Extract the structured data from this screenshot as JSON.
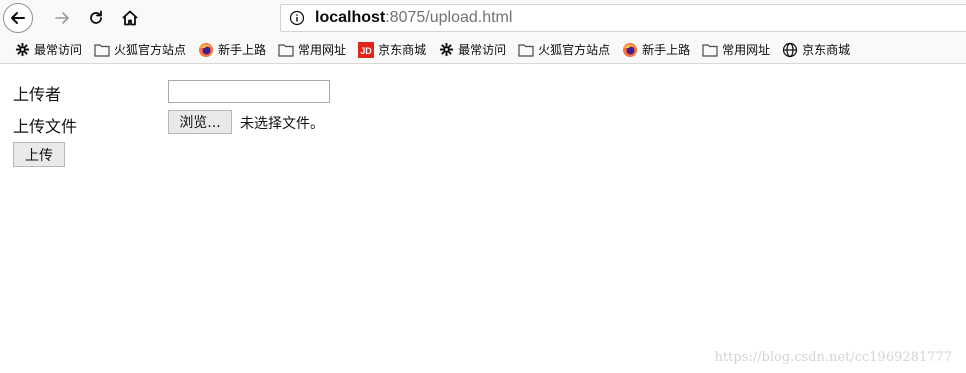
{
  "browser": {
    "url_host": "localhost",
    "url_rest": ":8075/upload.html"
  },
  "bookmarks": [
    {
      "label": "最常访问",
      "icon": "gear-icon"
    },
    {
      "label": "火狐官方站点",
      "icon": "folder-icon"
    },
    {
      "label": "新手上路",
      "icon": "firefox-icon"
    },
    {
      "label": "常用网址",
      "icon": "folder-icon"
    },
    {
      "label": "京东商城",
      "icon": "jd-icon"
    },
    {
      "label": "最常访问",
      "icon": "gear-icon"
    },
    {
      "label": "火狐官方站点",
      "icon": "folder-icon"
    },
    {
      "label": "新手上路",
      "icon": "firefox-icon"
    },
    {
      "label": "常用网址",
      "icon": "folder-icon"
    },
    {
      "label": "京东商城",
      "icon": "globe-icon"
    }
  ],
  "form": {
    "uploader_label": "上传者",
    "uploader_value": "",
    "file_label": "上传文件",
    "browse_label": "浏览...",
    "file_status": "未选择文件。",
    "submit_label": "上传"
  },
  "watermark": "https://blog.csdn.net/cc1969281777",
  "colors": {
    "toolbar_bg": "#f9f9fa",
    "button_bg": "#e9e9e9",
    "jd_red": "#e1251b"
  }
}
